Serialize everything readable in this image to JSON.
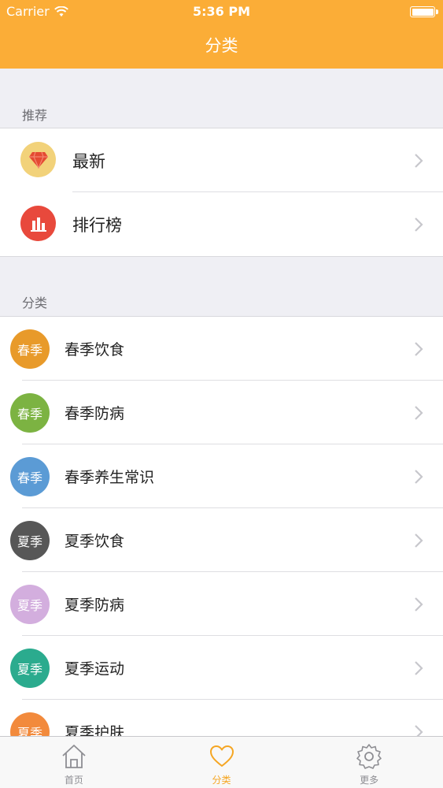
{
  "status_bar": {
    "carrier": "Carrier",
    "time": "5:36 PM"
  },
  "nav": {
    "title": "分类"
  },
  "sections": {
    "recommend": {
      "header": "推荐",
      "items": [
        {
          "label": "最新",
          "icon": "gem-icon",
          "icon_bg": "#f2d27a",
          "icon_color": "#e44a32"
        },
        {
          "label": "排行榜",
          "icon": "bar-chart-icon",
          "icon_bg": "#e8493c",
          "icon_color": "#ffffff"
        }
      ]
    },
    "category": {
      "header": "分类",
      "items": [
        {
          "badge": "春季",
          "label": "春季饮食",
          "color": "#e89a2a"
        },
        {
          "badge": "春季",
          "label": "春季防病",
          "color": "#7cb342"
        },
        {
          "badge": "春季",
          "label": "春季养生常识",
          "color": "#5b9bd5"
        },
        {
          "badge": "夏季",
          "label": "夏季饮食",
          "color": "#575757"
        },
        {
          "badge": "夏季",
          "label": "夏季防病",
          "color": "#d3aede"
        },
        {
          "badge": "夏季",
          "label": "夏季运动",
          "color": "#2bab8e"
        },
        {
          "badge": "夏季",
          "label": "夏季护肤",
          "color": "#f28a3c"
        }
      ]
    }
  },
  "tabbar": {
    "tabs": [
      {
        "label": "首页",
        "icon": "home-icon",
        "active": false
      },
      {
        "label": "分类",
        "icon": "heart-icon",
        "active": true
      },
      {
        "label": "更多",
        "icon": "gear-icon",
        "active": false
      }
    ]
  },
  "colors": {
    "accent": "#fbad37",
    "active_tab": "#f5a623",
    "inactive_tab": "#8e8e93",
    "chevron": "#c7c7cc"
  }
}
